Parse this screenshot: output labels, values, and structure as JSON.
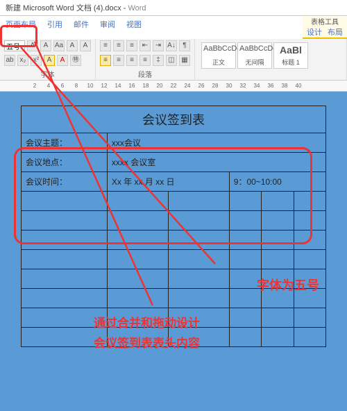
{
  "titlebar": {
    "doc": "新建 Microsoft Word 文档 (4).docx",
    "app": "Word"
  },
  "tabs": [
    "页面布局",
    "引用",
    "邮件",
    "审阅",
    "视图"
  ],
  "context": {
    "title": "表格工具",
    "tabs": [
      "设计",
      "布局"
    ]
  },
  "font": {
    "size_label": "五号",
    "group_label": "字体"
  },
  "para": {
    "group_label": "段落"
  },
  "styles": [
    {
      "sample": "AaBbCcDd",
      "name": "正文"
    },
    {
      "sample": "AaBbCcDd",
      "name": "无间隔"
    },
    {
      "sample": "AaBl",
      "name": "标题 1"
    }
  ],
  "ruler": [
    2,
    4,
    6,
    8,
    10,
    12,
    14,
    16,
    18,
    20,
    22,
    24,
    26,
    28,
    30,
    32,
    34,
    36,
    38,
    40
  ],
  "table": {
    "title": "会议签到表",
    "rows": [
      {
        "label": "会议主题：",
        "value": "xxx会议"
      },
      {
        "label": "会议地点：",
        "value": "xxxx 会议室"
      },
      {
        "label": "会议时间：",
        "value": "Xx 年 xx 月 xx 日",
        "time": "9：00~10:00"
      }
    ]
  },
  "annotations": {
    "fontsize_note": "字体为五号",
    "design_note_1": "通过合并和拖动设计",
    "design_note_2": "会议签到表表头内容"
  }
}
